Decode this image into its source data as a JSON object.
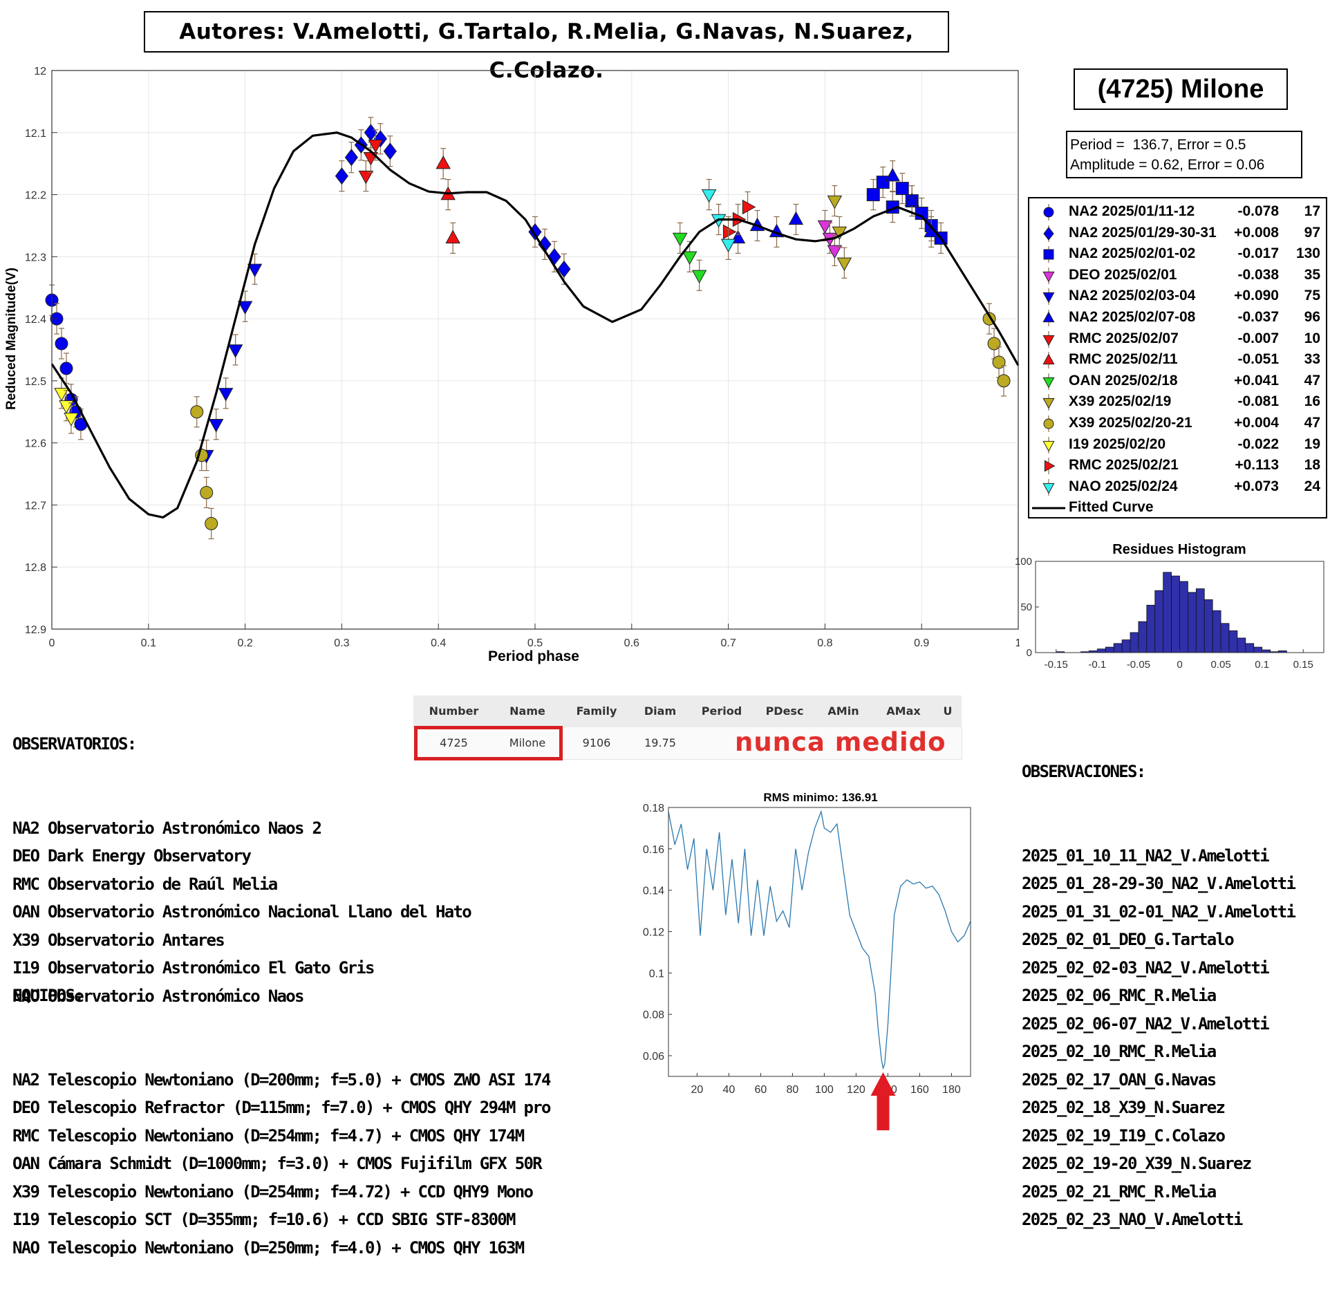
{
  "authors": "Autores: V.Amelotti, G.Tartalo, R.Melia, G.Navas, N.Suarez, C.Colazo.",
  "object_name": "(4725) Milone",
  "period_line": "Period =  136.7, Error = 0.5",
  "amplitude_line": "Amplitude = 0.62, Error = 0.06",
  "colors": {
    "blue": "#0000ee",
    "magenta": "#dd33dd",
    "red": "#ee1111",
    "green": "#22dd22",
    "olive": "#bbaa22",
    "yellow": "#ffff33",
    "cyan": "#33eeee",
    "histogram_bar": "#3030a8",
    "periodogram_line": "#2a78b0",
    "arrow": "#e01b24",
    "nunca": "#e0302e"
  },
  "legend": [
    {
      "name": "NA2 2025/01/11-12",
      "offset": "-0.078",
      "n": "17",
      "marker": "circle",
      "color": "#0000ee"
    },
    {
      "name": "NA2 2025/01/29-30-31",
      "offset": "+0.008",
      "n": "97",
      "marker": "diamond",
      "color": "#0000ee"
    },
    {
      "name": "NA2 2025/02/01-02",
      "offset": "-0.017",
      "n": "130",
      "marker": "square",
      "color": "#0000ee"
    },
    {
      "name": "DEO 2025/02/01",
      "offset": "-0.038",
      "n": "35",
      "marker": "tri-down",
      "color": "#dd33dd"
    },
    {
      "name": "NA2 2025/02/03-04",
      "offset": "+0.090",
      "n": "75",
      "marker": "tri-down",
      "color": "#0000ee"
    },
    {
      "name": "NA2 2025/02/07-08",
      "offset": "-0.037",
      "n": "96",
      "marker": "tri-up",
      "color": "#0000ee"
    },
    {
      "name": "RMC 2025/02/07",
      "offset": "-0.007",
      "n": "10",
      "marker": "tri-down",
      "color": "#ee1111"
    },
    {
      "name": "RMC 2025/02/11",
      "offset": "-0.051",
      "n": "33",
      "marker": "tri-up",
      "color": "#ee1111"
    },
    {
      "name": "OAN 2025/02/18",
      "offset": "+0.041",
      "n": "47",
      "marker": "tri-down",
      "color": "#22dd22"
    },
    {
      "name": "X39 2025/02/19",
      "offset": "-0.081",
      "n": "16",
      "marker": "tri-down",
      "color": "#bbaa22"
    },
    {
      "name": "X39 2025/02/20-21",
      "offset": "+0.004",
      "n": "47",
      "marker": "circle",
      "color": "#bbaa22"
    },
    {
      "name": "I19 2025/02/20",
      "offset": "-0.022",
      "n": "19",
      "marker": "tri-down",
      "color": "#ffff33"
    },
    {
      "name": "RMC 2025/02/21",
      "offset": "+0.113",
      "n": "18",
      "marker": "tri-right",
      "color": "#ee1111"
    },
    {
      "name": "NAO 2025/02/24",
      "offset": "+0.073",
      "n": "24",
      "marker": "tri-down",
      "color": "#33eeee"
    },
    {
      "name": "Fitted Curve",
      "offset": "",
      "n": "",
      "marker": "line",
      "color": "#000000"
    }
  ],
  "observatorios": {
    "title": "OBSERVATORIOS:",
    "items": [
      "NA2 Observatorio Astronómico Naos 2",
      "DEO Dark Energy Observatory",
      "RMC Observatorio de Raúl Melia",
      "OAN Observatorio Astronómico Nacional Llano del Hato",
      "X39 Observatorio Antares",
      "I19 Observatorio Astronómico El Gato Gris",
      "NAO Observatorio Astronómico Naos"
    ]
  },
  "equipos": {
    "title": "EQUIPOS:",
    "items": [
      "NA2 Telescopio Newtoniano (D=200mm; f=5.0) + CMOS ZWO ASI 174",
      "DEO Telescopio Refractor (D=115mm; f=7.0) + CMOS QHY 294M pro",
      "RMC Telescopio Newtoniano (D=254mm; f=4.7) + CMOS QHY 174M",
      "OAN Cámara Schmidt (D=1000mm; f=3.0) + CMOS Fujifilm GFX 50R",
      "X39 Telescopio Newtoniano (D=254mm; f=4.72) + CCD QHY9 Mono",
      "I19 Telescopio SCT (D=355mm; f=10.6) + CCD SBIG STF-8300M",
      "NAO Telescopio Newtoniano (D=250mm; f=4.0) + CMOS QHY 163M"
    ]
  },
  "observaciones": {
    "title": "OBSERVACIONES:",
    "items": [
      "2025_01_10_11_NA2_V.Amelotti",
      "2025_01_28-29-30_NA2_V.Amelotti",
      "2025_01_31_02-01_NA2_V.Amelotti",
      "2025_02_01_DEO_G.Tartalo",
      "2025_02_02-03_NA2_V.Amelotti",
      "2025_02_06_RMC_R.Melia",
      "2025_02_06-07_NA2_V.Amelotti",
      "2025_02_10_RMC_R.Melia",
      "2025_02_17_OAN_G.Navas",
      "2025_02_18_X39_N.Suarez",
      "2025_02_19_I19_C.Colazo",
      "2025_02_19-20_X39_N.Suarez",
      "2025_02_21_RMC_R.Melia",
      "2025_02_23_NAO_V.Amelotti"
    ]
  },
  "table": {
    "headers": [
      "Number",
      "Name",
      "Family",
      "Diam",
      "Period",
      "PDesc",
      "AMin",
      "AMax",
      "U"
    ],
    "row": [
      "4725",
      "Milone",
      "9106",
      "19.75",
      "",
      "",
      "",
      "",
      ""
    ],
    "note": "nunca medido"
  },
  "chart_data": [
    {
      "type": "scatter",
      "title": "",
      "xlabel": "Period phase",
      "ylabel": "Reduced Magnitude(V)",
      "xlim": [
        0,
        1
      ],
      "ylim": [
        12.9,
        12.0
      ],
      "y_reversed": true,
      "xticks": [
        "0",
        "0.1",
        "0.2",
        "0.3",
        "0.4",
        "0.5",
        "0.6",
        "0.7",
        "0.8",
        "0.9",
        "1"
      ],
      "yticks": [
        "12",
        "12.1",
        "12.2",
        "12.3",
        "12.4",
        "12.5",
        "12.6",
        "12.7",
        "12.8",
        "12.9"
      ],
      "grid": true,
      "legend_position": "right",
      "fitted_curve": {
        "name": "Fitted Curve",
        "x": [
          0.0,
          0.02,
          0.04,
          0.06,
          0.08,
          0.1,
          0.115,
          0.13,
          0.15,
          0.17,
          0.19,
          0.21,
          0.23,
          0.25,
          0.27,
          0.295,
          0.31,
          0.33,
          0.35,
          0.37,
          0.39,
          0.41,
          0.43,
          0.45,
          0.47,
          0.49,
          0.51,
          0.53,
          0.55,
          0.58,
          0.61,
          0.63,
          0.65,
          0.67,
          0.69,
          0.71,
          0.73,
          0.75,
          0.77,
          0.79,
          0.81,
          0.83,
          0.85,
          0.875,
          0.9,
          0.92,
          0.94,
          0.96,
          0.98,
          1.0
        ],
        "y": [
          12.473,
          12.52,
          12.58,
          12.64,
          12.69,
          12.715,
          12.72,
          12.705,
          12.63,
          12.52,
          12.4,
          12.28,
          12.19,
          12.13,
          12.105,
          12.1,
          12.108,
          12.13,
          12.16,
          12.182,
          12.195,
          12.198,
          12.196,
          12.196,
          12.21,
          12.24,
          12.29,
          12.34,
          12.38,
          12.405,
          12.385,
          12.345,
          12.3,
          12.26,
          12.24,
          12.24,
          12.25,
          12.262,
          12.272,
          12.275,
          12.27,
          12.255,
          12.235,
          12.22,
          12.235,
          12.27,
          12.32,
          12.37,
          12.42,
          12.475
        ]
      },
      "series": [
        {
          "name": "NA2 2025/01/11-12",
          "x": [
            0.0,
            0.005,
            0.01,
            0.015,
            0.02,
            0.025,
            0.03
          ],
          "y": [
            12.37,
            12.4,
            12.44,
            12.48,
            12.53,
            12.55,
            12.57
          ]
        },
        {
          "name": "NA2 2025/01/29-30-31",
          "x": [
            0.3,
            0.31,
            0.32,
            0.33,
            0.34,
            0.35,
            0.5,
            0.51,
            0.52,
            0.53
          ],
          "y": [
            12.17,
            12.14,
            12.12,
            12.1,
            12.11,
            12.13,
            12.26,
            12.28,
            12.3,
            12.32
          ]
        },
        {
          "name": "NA2 2025/02/01-02",
          "x": [
            0.85,
            0.86,
            0.87,
            0.88,
            0.89,
            0.9,
            0.91,
            0.92
          ],
          "y": [
            12.2,
            12.18,
            12.22,
            12.19,
            12.21,
            12.23,
            12.25,
            12.27
          ]
        },
        {
          "name": "DEO 2025/02/01",
          "x": [
            0.8,
            0.805,
            0.81
          ],
          "y": [
            12.25,
            12.27,
            12.29
          ]
        },
        {
          "name": "NA2 2025/02/03-04",
          "x": [
            0.16,
            0.17,
            0.18,
            0.19,
            0.2,
            0.21
          ],
          "y": [
            12.62,
            12.57,
            12.52,
            12.45,
            12.38,
            12.32
          ]
        },
        {
          "name": "NA2 2025/02/07-08",
          "x": [
            0.71,
            0.73,
            0.75,
            0.77,
            0.87,
            0.89,
            0.91
          ],
          "y": [
            12.27,
            12.25,
            12.26,
            12.24,
            12.17,
            12.21,
            12.26
          ]
        },
        {
          "name": "RMC 2025/02/07",
          "x": [
            0.325,
            0.33,
            0.335
          ],
          "y": [
            12.17,
            12.14,
            12.12
          ]
        },
        {
          "name": "RMC 2025/02/11",
          "x": [
            0.405,
            0.41,
            0.415
          ],
          "y": [
            12.15,
            12.2,
            12.27
          ]
        },
        {
          "name": "OAN 2025/02/18",
          "x": [
            0.65,
            0.66,
            0.67
          ],
          "y": [
            12.27,
            12.3,
            12.33
          ]
        },
        {
          "name": "X39 2025/02/19",
          "x": [
            0.81,
            0.815,
            0.82
          ],
          "y": [
            12.21,
            12.26,
            12.31
          ]
        },
        {
          "name": "X39 2025/02/20-21",
          "x": [
            0.15,
            0.155,
            0.16,
            0.165,
            0.97,
            0.975,
            0.98,
            0.985
          ],
          "y": [
            12.55,
            12.62,
            12.68,
            12.73,
            12.4,
            12.44,
            12.47,
            12.5
          ]
        },
        {
          "name": "I19 2025/02/20",
          "x": [
            0.01,
            0.015,
            0.02
          ],
          "y": [
            12.52,
            12.54,
            12.56
          ]
        },
        {
          "name": "RMC 2025/02/21",
          "x": [
            0.7,
            0.71,
            0.72
          ],
          "y": [
            12.26,
            12.24,
            12.22
          ]
        },
        {
          "name": "NAO 2025/02/24",
          "x": [
            0.68,
            0.69,
            0.7
          ],
          "y": [
            12.2,
            12.24,
            12.28
          ]
        }
      ]
    },
    {
      "type": "bar",
      "title": "Residues Histogram",
      "xlim": [
        -0.175,
        0.175
      ],
      "ylim": [
        0,
        100
      ],
      "xticks": [
        "-0.15",
        "-0.1",
        "-0.05",
        "0",
        "0.05",
        "0.1",
        "0.15"
      ],
      "yticks": [
        "0",
        "50",
        "100"
      ],
      "bin_width": 0.01,
      "bin_starts": [
        -0.15,
        -0.14,
        -0.13,
        -0.12,
        -0.11,
        -0.1,
        -0.09,
        -0.08,
        -0.07,
        -0.06,
        -0.05,
        -0.04,
        -0.03,
        -0.02,
        -0.01,
        0.0,
        0.01,
        0.02,
        0.03,
        0.04,
        0.05,
        0.06,
        0.07,
        0.08,
        0.09,
        0.1,
        0.11,
        0.12,
        0.13
      ],
      "values": [
        1,
        0,
        0,
        1,
        2,
        4,
        6,
        10,
        14,
        22,
        34,
        52,
        68,
        88,
        84,
        78,
        66,
        70,
        58,
        46,
        32,
        24,
        16,
        10,
        6,
        3,
        1,
        2,
        0
      ]
    },
    {
      "type": "line",
      "title": "RMS minimo: 136.91",
      "xlim": [
        2,
        192
      ],
      "ylim": [
        0.05,
        0.18
      ],
      "xticks": [
        "20",
        "40",
        "60",
        "80",
        "100",
        "120",
        "140",
        "160",
        "180"
      ],
      "yticks": [
        "0.06",
        "0.08",
        "0.1",
        "0.12",
        "0.14",
        "0.16",
        "0.18"
      ],
      "x": [
        2,
        6,
        10,
        14,
        18,
        22,
        26,
        30,
        34,
        38,
        42,
        46,
        50,
        54,
        58,
        62,
        66,
        70,
        74,
        78,
        82,
        86,
        90,
        94,
        98,
        100,
        104,
        108,
        112,
        116,
        120,
        124,
        128,
        132,
        134,
        136,
        137,
        138,
        140,
        144,
        148,
        152,
        156,
        160,
        164,
        168,
        172,
        176,
        180,
        184,
        188,
        192
      ],
      "y": [
        0.178,
        0.162,
        0.172,
        0.15,
        0.165,
        0.118,
        0.16,
        0.14,
        0.168,
        0.128,
        0.155,
        0.124,
        0.16,
        0.118,
        0.145,
        0.118,
        0.142,
        0.125,
        0.13,
        0.122,
        0.16,
        0.14,
        0.158,
        0.17,
        0.178,
        0.17,
        0.168,
        0.172,
        0.15,
        0.128,
        0.12,
        0.112,
        0.108,
        0.09,
        0.072,
        0.058,
        0.054,
        0.056,
        0.075,
        0.128,
        0.142,
        0.145,
        0.143,
        0.144,
        0.141,
        0.142,
        0.138,
        0.13,
        0.12,
        0.115,
        0.118,
        0.125
      ]
    }
  ]
}
